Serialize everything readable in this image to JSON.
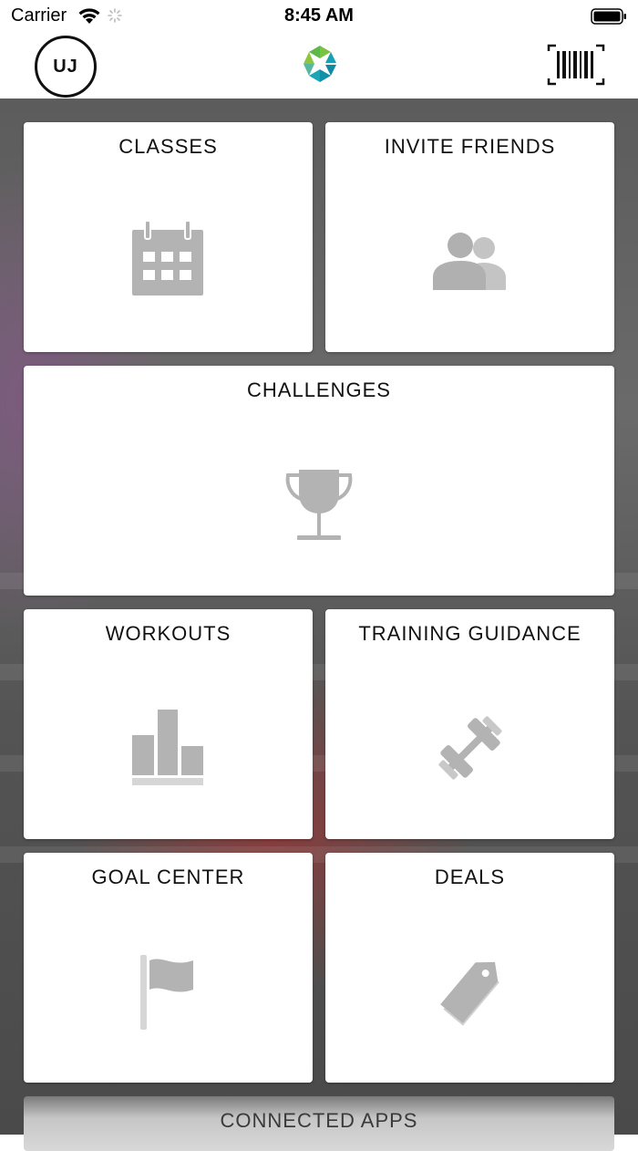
{
  "status_bar": {
    "carrier": "Carrier",
    "time": "8:45 AM"
  },
  "nav": {
    "avatar_initials": "UJ",
    "logo_icon": "app-logo",
    "scan_icon": "barcode-icon"
  },
  "tiles": {
    "classes": "CLASSES",
    "invite_friends": "INVITE FRIENDS",
    "challenges": "CHALLENGES",
    "workouts": "WORKOUTS",
    "training_guidance": "TRAINING GUIDANCE",
    "goal_center": "GOAL CENTER",
    "deals": "DEALS",
    "connected_apps": "CONNECTED APPS"
  },
  "colors": {
    "icon_gray": "#b3b3b3",
    "logo_green": "#7cc242",
    "logo_teal": "#1aa6b7"
  }
}
